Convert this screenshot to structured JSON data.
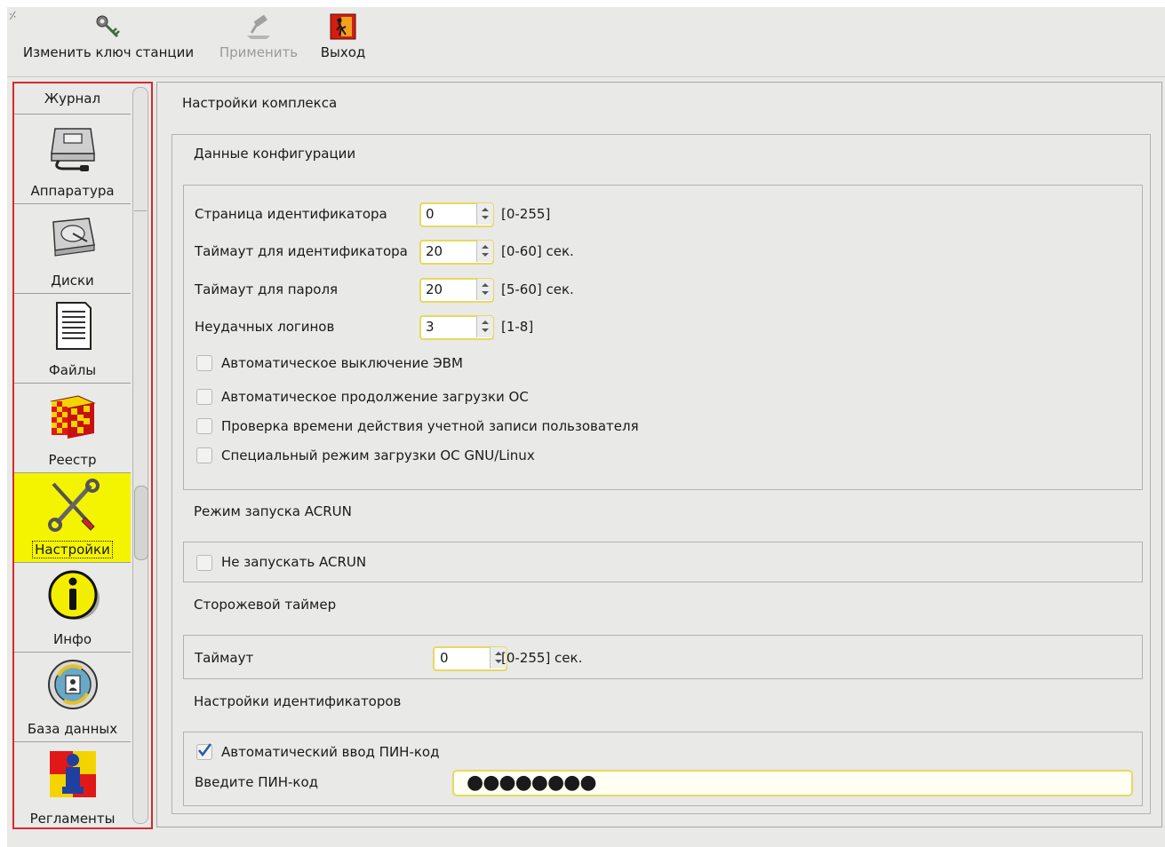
{
  "toolbar": {
    "change_key_label": "Изменить ключ станции",
    "apply_label": "Применить",
    "exit_label": "Выход"
  },
  "sidebar": {
    "top_label": "Журнал",
    "items": [
      {
        "label": "Аппаратура",
        "icon": "hardware-icon"
      },
      {
        "label": "Диски",
        "icon": "disk-icon"
      },
      {
        "label": "Файлы",
        "icon": "file-icon"
      },
      {
        "label": "Реестр",
        "icon": "registry-cube-icon"
      },
      {
        "label": "Настройки",
        "icon": "tools-icon",
        "active": true
      },
      {
        "label": "Инфо",
        "icon": "info-icon"
      },
      {
        "label": "База данных",
        "icon": "database-icon"
      },
      {
        "label": "Регламенты",
        "icon": "regulations-icon"
      }
    ]
  },
  "main": {
    "title": "Настройки комплекса",
    "config": {
      "title": "Данные конфигурации",
      "fields": [
        {
          "label": "Страница идентификатора",
          "value": "0",
          "range": "[0-255]"
        },
        {
          "label": "Таймаут для идентификатора",
          "value": "20",
          "range": "[0-60] сек."
        },
        {
          "label": "Таймаут для пароля",
          "value": "20",
          "range": "[5-60] сек."
        },
        {
          "label": "Неудачных логинов",
          "value": "3",
          "range": "[1-8]"
        }
      ],
      "checkboxes": [
        {
          "label": "Автоматическое выключение ЭВМ",
          "checked": false
        },
        {
          "label": "Автоматическое продолжение загрузки ОС",
          "checked": false
        },
        {
          "label": "Проверка времени действия учетной записи пользователя",
          "checked": false
        },
        {
          "label": "Специальный режим загрузки ОС GNU/Linux",
          "checked": false
        }
      ]
    },
    "acrun": {
      "title": "Режим запуска ACRUN",
      "checkbox_label": "Не запускать ACRUN"
    },
    "watchdog": {
      "title": "Сторожевой таймер",
      "label": "Таймаут",
      "value": "0",
      "range": "[0-255] сек."
    },
    "identifiers": {
      "title": "Настройки идентификаторов",
      "auto_pin_label": "Автоматический ввод ПИН-код",
      "auto_pin_checked": true,
      "pin_label": "Введите ПИН-код",
      "pin_value": "●●●●●●●●"
    }
  }
}
